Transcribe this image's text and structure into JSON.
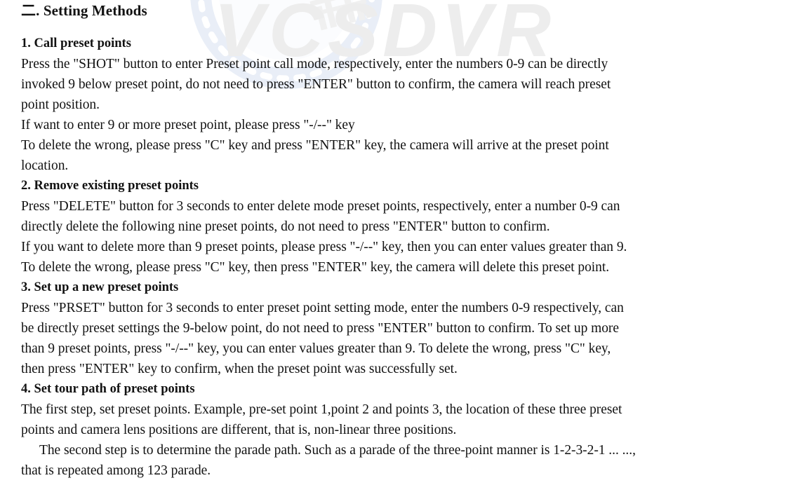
{
  "document": {
    "heading": {
      "numeral": "二",
      "separator": ". ",
      "title": "Setting Methods",
      "full": "二. Setting Methods"
    },
    "watermark": {
      "text": "VCSDVR",
      "text_color": "#ededed",
      "ring_color": "#e9eef7",
      "type": "film-reel-logo"
    },
    "page_color": "#ffffff",
    "text_color": "#121212",
    "sections": [
      {
        "number": "1.",
        "title": "1. Call preset points",
        "lines": [
          "Press the \"SHOT\" button to enter Preset point call mode, respectively, enter the numbers 0-9 can be directly",
          "invoked 9 below preset point, do not need to press \"ENTER\" button to confirm, the camera will reach preset",
          "point position.",
          "If want to enter 9 or more preset point, please press \"-/--\" key",
          "To delete the wrong, please press \"C\" key and press \"ENTER\" key, the camera will arrive at the preset point",
          "location."
        ]
      },
      {
        "number": "2.",
        "title": "2. Remove existing preset points",
        "lines": [
          "Press \"DELETE\" button for 3 seconds to enter delete mode preset points, respectively, enter a number 0-9 can",
          "directly delete the following nine preset points, do not need to press \"ENTER\" button to confirm.",
          "If you want to delete more than 9 preset points, please press \"-/--\" key, then you can enter values greater than 9.",
          "To delete the wrong, please press \"C\" key, then press \"ENTER\" key, the camera will delete this preset point."
        ]
      },
      {
        "number": "3.",
        "title": "3. Set up a new preset points",
        "lines": [
          "Press \"PRSET\" button for 3 seconds to enter preset point setting mode, enter the numbers 0-9 respectively, can",
          "be directly preset settings the 9-below point, do not need to press \"ENTER\" button to confirm. To set up more",
          "than 9 preset points, press \"-/--\" key, you can enter values greater than 9. To delete the wrong, press \"C\" key,",
          "then press \"ENTER\" key to confirm, when the preset point was successfully set."
        ]
      },
      {
        "number": "4.",
        "title": "4. Set tour path of preset points",
        "lines": [
          "The first step, set preset points. Example, pre-set point 1,point 2 and points 3, the location of these three preset",
          "points and camera lens positions are different, that is, non-linear three positions.",
          "The second step is to determine the parade path. Such as a parade of the three-point manner is 1-2-3-2-1 ... ...,",
          "that is repeated among 123 parade."
        ],
        "indent_line_index": 2
      }
    ]
  }
}
